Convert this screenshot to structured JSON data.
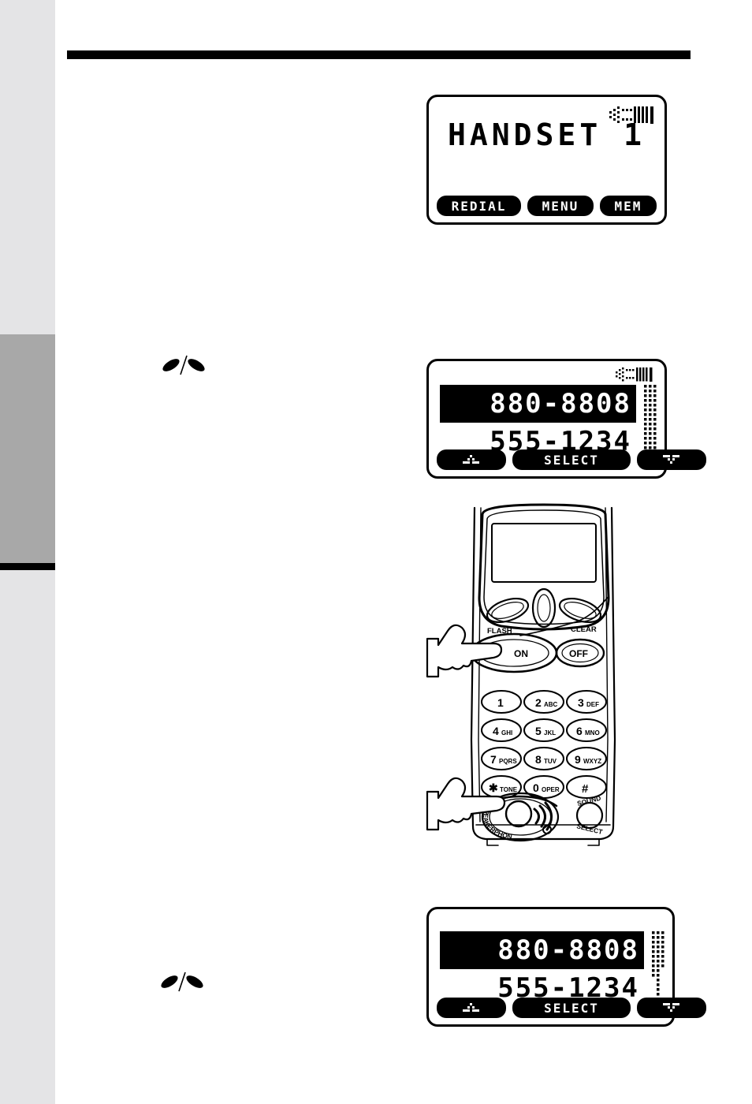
{
  "page": {
    "background_color": "#ffffff",
    "margin_strip_color": "#e4e4e6",
    "thumb_tab_color": "#a8a8a8",
    "rule_color": "#000000"
  },
  "displays": [
    {
      "id": "lcd-handset-standby",
      "title_text": "HANDSET 1",
      "indicator": "signal-strength-icon",
      "softkeys": [
        {
          "label": "REDIAL",
          "name": "softkey-redial"
        },
        {
          "label": "MENU",
          "name": "softkey-menu"
        },
        {
          "label": "MEM",
          "name": "softkey-mem"
        }
      ]
    },
    {
      "id": "lcd-number-list-upper",
      "indicator": "signal-strength-icon",
      "rows": [
        {
          "value": "880-8808",
          "selected": true
        },
        {
          "value": "555-1234",
          "selected": false
        }
      ],
      "softkeys": [
        {
          "label": "",
          "name": "softkey-scroll-up",
          "icon": "up-arrow-icon"
        },
        {
          "label": "SELECT",
          "name": "softkey-select"
        },
        {
          "label": "",
          "name": "softkey-scroll-down",
          "icon": "down-arrow-icon"
        }
      ],
      "scrollbar": "scrollbar-dot-matrix"
    },
    {
      "id": "lcd-number-list-lower",
      "indicator": "none",
      "rows": [
        {
          "value": "880-8808",
          "selected": true
        },
        {
          "value": "555-1234",
          "selected": false
        }
      ],
      "softkeys": [
        {
          "label": "",
          "name": "softkey-scroll-up",
          "icon": "up-arrow-icon"
        },
        {
          "label": "SELECT",
          "name": "softkey-select"
        },
        {
          "label": "",
          "name": "softkey-scroll-down",
          "icon": "down-arrow-icon"
        }
      ],
      "scrollbar": "scrollbar-dot-matrix"
    }
  ],
  "step_markers": [
    {
      "name": "scroll-step-marker-1",
      "icon": "scroll-up-down-icon"
    },
    {
      "name": "scroll-step-marker-2",
      "icon": "scroll-up-down-icon"
    }
  ],
  "handset": {
    "name": "cordless-handset-illustration",
    "top_labels": {
      "flash": "FLASH",
      "clear": "CLEAR"
    },
    "talk_keys": [
      {
        "label": "ON",
        "name": "handset-on-key"
      },
      {
        "label": "OFF",
        "name": "handset-off-key"
      }
    ],
    "keypad": [
      {
        "digit": "1",
        "letters": ""
      },
      {
        "digit": "2",
        "letters": "ABC"
      },
      {
        "digit": "3",
        "letters": "DEF"
      },
      {
        "digit": "4",
        "letters": "GHI"
      },
      {
        "digit": "5",
        "letters": "JKL"
      },
      {
        "digit": "6",
        "letters": "MNO"
      },
      {
        "digit": "7",
        "letters": "PQRS"
      },
      {
        "digit": "8",
        "letters": "TUV"
      },
      {
        "digit": "9",
        "letters": "WXYZ"
      },
      {
        "digit": "✳",
        "letters": "TONE"
      },
      {
        "digit": "0",
        "letters": "OPER"
      },
      {
        "digit": "#",
        "letters": ""
      }
    ],
    "bottom_keys": [
      {
        "label": "SPEAKERPHONE",
        "name": "speakerphone-key"
      },
      {
        "label_line1": "SOUND",
        "label_line2": "SELECT",
        "name": "sound-select-key"
      }
    ],
    "pointers": [
      {
        "name": "pointing-hand-on-key",
        "target": "handset-on-key"
      },
      {
        "name": "pointing-hand-speakerphone",
        "target": "speakerphone-key"
      }
    ]
  }
}
